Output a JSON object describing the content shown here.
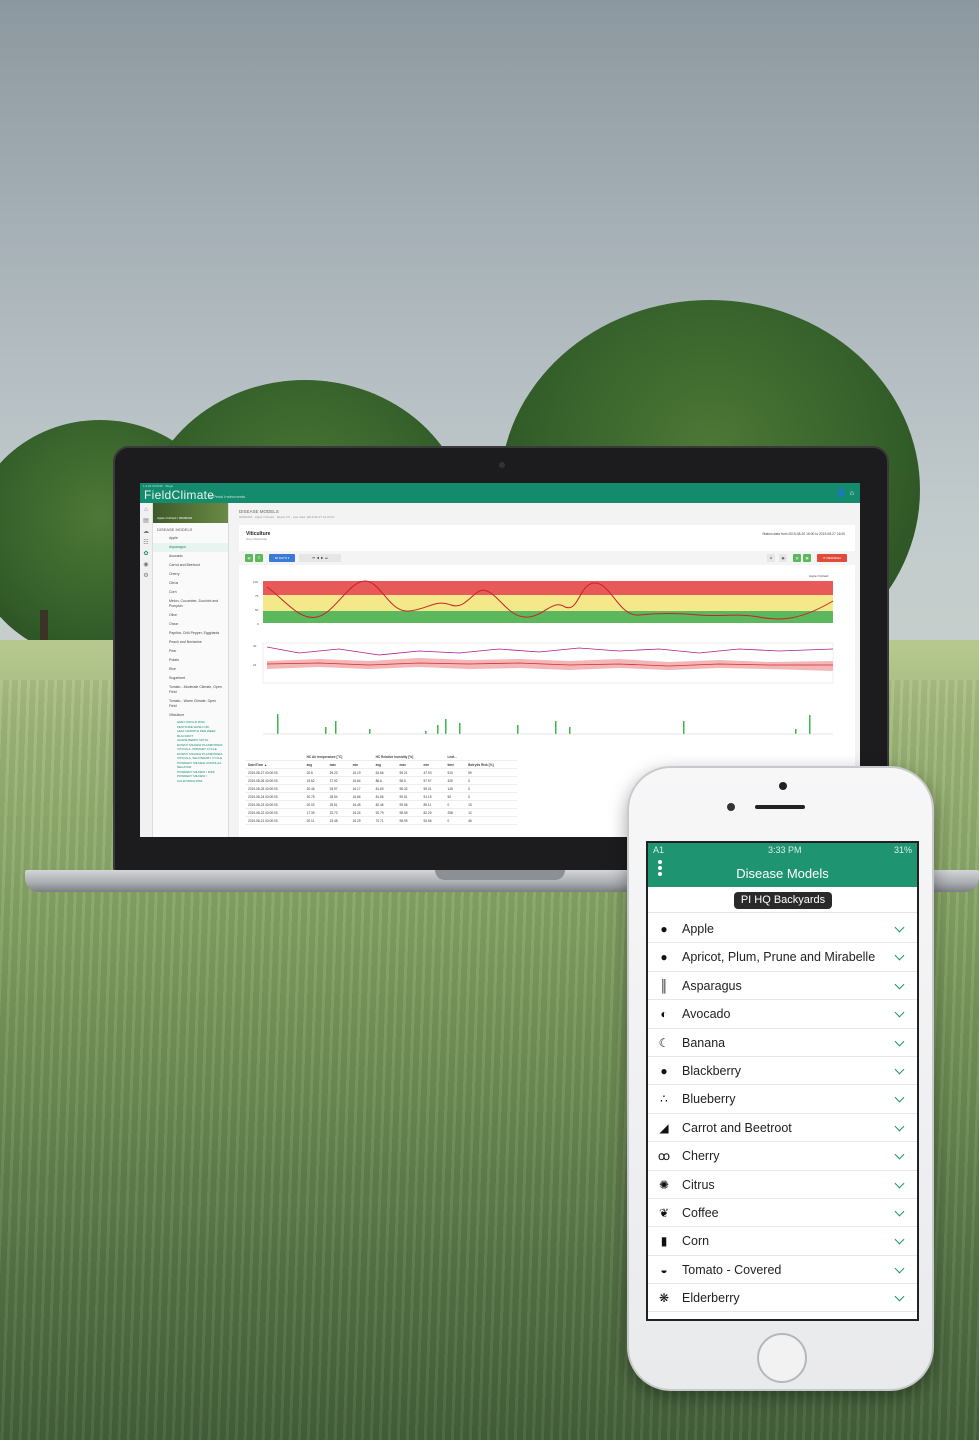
{
  "laptop": {
    "build": "1.4.20 UI/0726 · Wego",
    "brand": "FieldClimate",
    "brand_by": "by Pessl Instruments",
    "station": "Apple Orchard / 00000264",
    "sidebar_title": "DISEASE MODELS",
    "sidebar_items": [
      "Apple",
      "Asparagus",
      "Avocado",
      "Carrot and Beetroot",
      "Cherry",
      "Citrus",
      "Corn",
      "Melon, Cucumber, Zucchini and Pumpkin",
      "Olive",
      "Onion",
      "Paprika, Chili Pepper, Eggplants",
      "Peach and Nectarine",
      "Pear",
      "Potato",
      "Rice",
      "Sugarbeet",
      "Tomato - Moderate Climate, Open Field",
      "Tomato - Warm Climate, Open Field",
      "Viticulture"
    ],
    "sidebar_active": "Asparagus",
    "sidebar_subitems": [
      "GREY MOULD RISK",
      "PESTICIDE WASH OFF",
      "LEAF GROWTH PER WEEK",
      "BLACKROT",
      "GRAPE BERRY MOTH",
      "DOWNY MILDEW PLASMOPARA VITICOLA, PRIMARY CYCLE",
      "DOWNY MILDEW PLASMOPARA VITICOLA, SECONDARY CYCLE",
      "POWDERY MILDEW UNCINULA NECATOR",
      "POWDERY MILDEW / RISK",
      "POWDERY MILDEW / CALIFORNIA RISK"
    ],
    "crumb_title": "DISEASE MODELS",
    "crumb_sub": "00000264 · Apple Orchard · Metos 3.0 · Last data: 2019-08-27 16:00:07",
    "panel_title": "Viticulture",
    "panel_sub": "Grey Mould risk",
    "range_text": "Station data from 2019-08-20 16:00 to 2019-08-27 16:00",
    "toolbar": {
      "days": "30 DAYS ▾",
      "refresh": "⟳ REFRESH"
    },
    "chart_label": "Apple Orchard",
    "table": {
      "groups": [
        "HC Air temperature [°C]",
        "HC Relative humidity [%]",
        "Leaf..."
      ],
      "headers": [
        "Date/Time ▲",
        "avg",
        "max",
        "min",
        "avg",
        "max",
        "min",
        "time",
        "Botrytis Risk [%]"
      ],
      "rows": [
        [
          "2019-08-27 00:00:00",
          "20.6",
          "29.23",
          "15.19",
          "63.66",
          "99.21",
          "47.93",
          "510",
          "59"
        ],
        [
          "2019-08-26 00:00:00",
          "19.62",
          "27.92",
          "15.64",
          "86.6",
          "98.5",
          "57.97",
          "325",
          "0"
        ],
        [
          "2019-08-25 00:00:00",
          "20.46",
          "25.97",
          "16.17",
          "81.69",
          "98.32",
          "59.01",
          "145",
          "0"
        ],
        [
          "2019-08-24 00:00:00",
          "20.75",
          "28.54",
          "16.66",
          "81.66",
          "99.51",
          "51.15",
          "50",
          "0"
        ],
        [
          "2019-08-23 00:00:00",
          "20.03",
          "25.51",
          "16.45",
          "82.46",
          "99.56",
          "89.11",
          "0",
          "15"
        ],
        [
          "2019-08-22 00:00:00",
          "17.39",
          "22.73",
          "15.24",
          "92.79",
          "98.59",
          "82.29",
          "258",
          "12"
        ],
        [
          "2019-08-21 00:00:00",
          "20.11",
          "23.48",
          "15.29",
          "70.71",
          "98.99",
          "53.56",
          "0",
          "46"
        ]
      ]
    }
  },
  "phone": {
    "carrier": "A1",
    "time": "3:33 PM",
    "battery": "31%",
    "title": "Disease Models",
    "location": "PI HQ Backyards",
    "items": [
      {
        "label": "Apple",
        "icon": "apple-icon",
        "glyph": "●"
      },
      {
        "label": "Apricot, Plum, Prune and Mirabelle",
        "icon": "apricot-icon",
        "glyph": "●"
      },
      {
        "label": "Asparagus",
        "icon": "asparagus-icon",
        "glyph": "║"
      },
      {
        "label": "Avocado",
        "icon": "avocado-icon",
        "glyph": "◐"
      },
      {
        "label": "Banana",
        "icon": "banana-icon",
        "glyph": "☾"
      },
      {
        "label": "Blackberry",
        "icon": "blackberry-icon",
        "glyph": "●"
      },
      {
        "label": "Blueberry",
        "icon": "blueberry-icon",
        "glyph": "∴"
      },
      {
        "label": "Carrot and Beetroot",
        "icon": "carrot-icon",
        "glyph": "◢"
      },
      {
        "label": "Cherry",
        "icon": "cherry-icon",
        "glyph": "ꝏ"
      },
      {
        "label": "Citrus",
        "icon": "citrus-icon",
        "glyph": "✺"
      },
      {
        "label": "Coffee",
        "icon": "coffee-bean-icon",
        "glyph": "❦"
      },
      {
        "label": "Corn",
        "icon": "corn-icon",
        "glyph": "▮"
      },
      {
        "label": "Tomato - Covered",
        "icon": "tomato-covered-icon",
        "glyph": "◒"
      },
      {
        "label": "Elderberry",
        "icon": "elderberry-icon",
        "glyph": "❋"
      }
    ]
  },
  "colors": {
    "brand_green": "#1f9470",
    "risk_high": "#e8595a",
    "risk_mid": "#f3e98a",
    "risk_low": "#5cb85c"
  }
}
